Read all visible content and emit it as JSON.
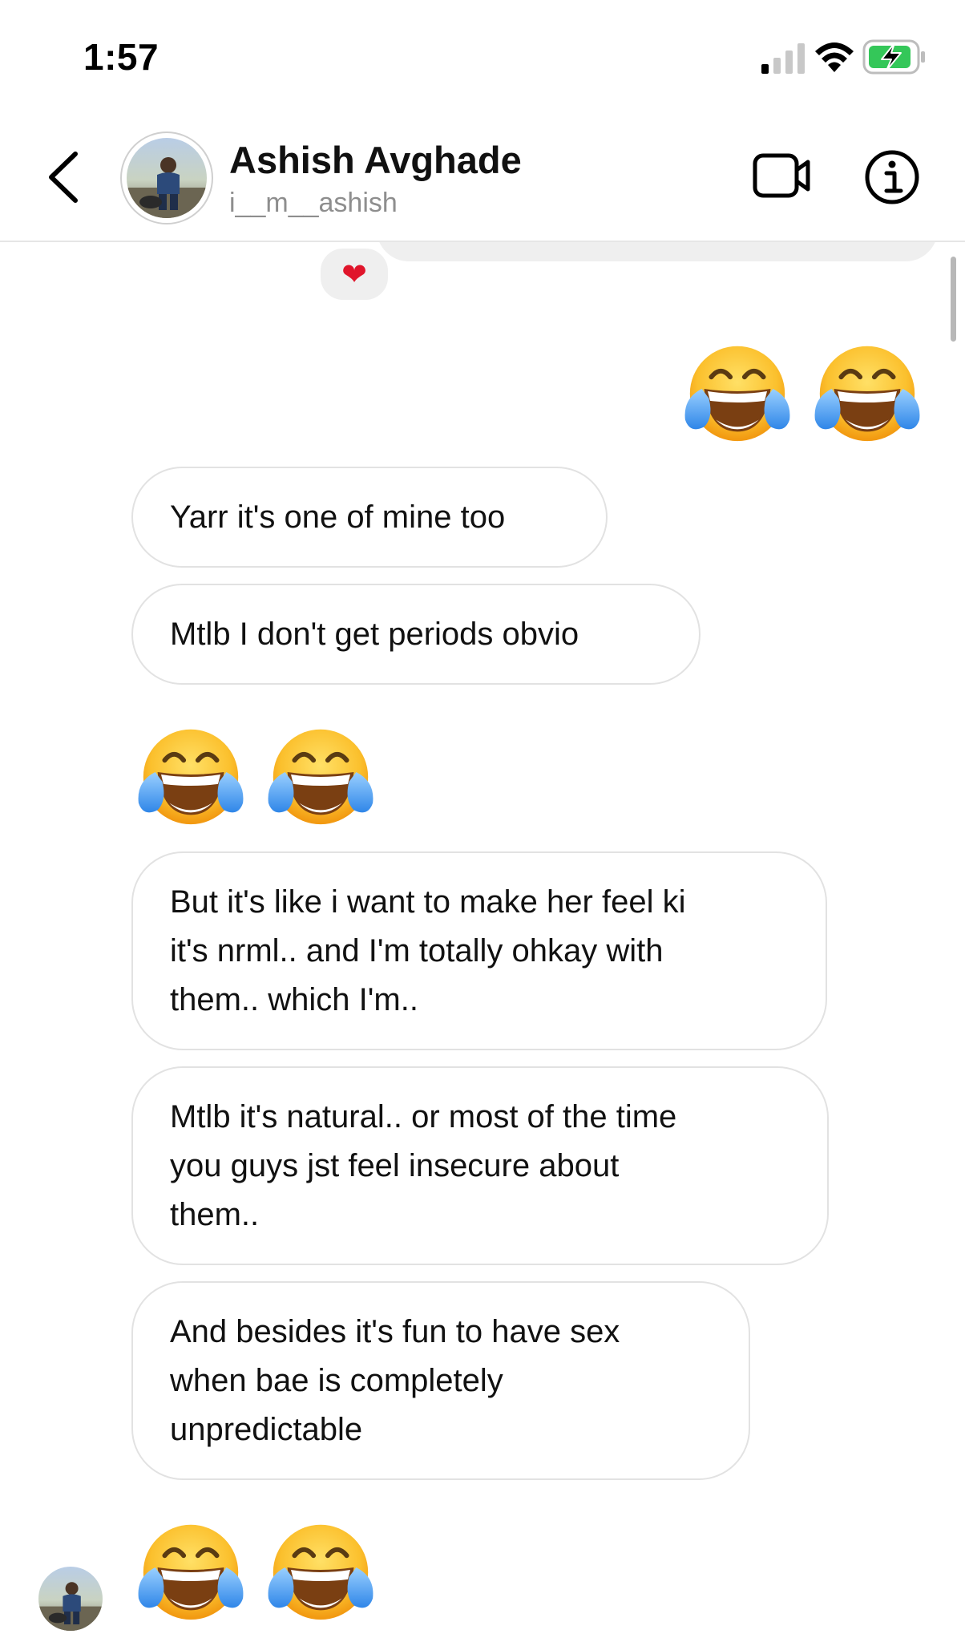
{
  "status_bar": {
    "time": "1:57"
  },
  "header": {
    "contact_name": "Ashish Avghade",
    "username": "i__m__ashish",
    "icons": [
      "back-chevron-icon",
      "video-camera-icon",
      "info-icon"
    ]
  },
  "thread": {
    "reaction_emoji": "❤",
    "messages": [
      {
        "sender": "me",
        "type": "emoji",
        "emoji_name": "face-with-tears-of-joy",
        "count": 2
      },
      {
        "sender": "them",
        "type": "text",
        "text": "Yarr it's one of mine too"
      },
      {
        "sender": "them",
        "type": "text",
        "text": "Mtlb I don't get periods obvio"
      },
      {
        "sender": "them",
        "type": "emoji",
        "emoji_name": "face-with-tears-of-joy",
        "count": 2
      },
      {
        "sender": "them",
        "type": "text",
        "text": "But it's like i want to make her feel ki\nit's nrml.. and I'm totally ohkay with\nthem.. which I'm.."
      },
      {
        "sender": "them",
        "type": "text",
        "text": "Mtlb it's natural.. or most of the time\nyou guys jst feel insecure about\nthem.."
      },
      {
        "sender": "them",
        "type": "text",
        "text": "And besides it's fun to have sex\nwhen bae is completely\nunpredictable"
      },
      {
        "sender": "them",
        "type": "emoji",
        "emoji_name": "face-with-tears-of-joy",
        "count": 2
      }
    ]
  },
  "colors": {
    "bubble_border": "#e2e2e2",
    "secondary_text": "#8e8e8e",
    "battery_charging": "#34c759",
    "reaction_heart": "#e0152b"
  }
}
